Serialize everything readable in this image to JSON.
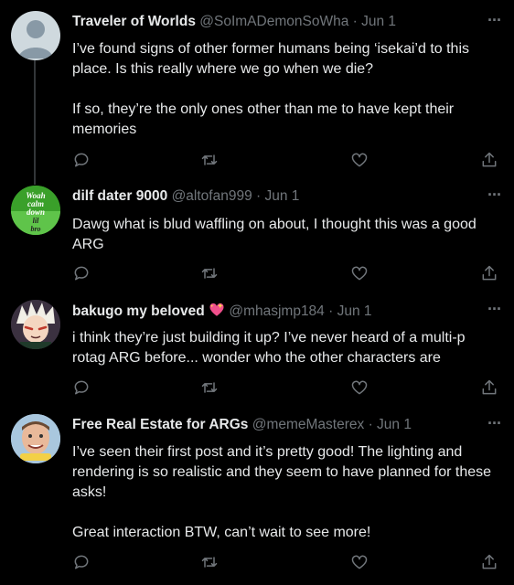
{
  "tweets": [
    {
      "name": "Traveler of Worlds",
      "handle": "@SoImADemonSoWha",
      "dot": "·",
      "date": "Jun 1",
      "more": "···",
      "paragraphs": [
        "I’ve found signs of other former humans being ‘isekai’d to this place. Is this really where we go when we die?",
        "If so, they’re the only ones other than me to have kept their memories"
      ],
      "avatar": "default-avatar"
    },
    {
      "name": "dilf dater 9000",
      "handle": "@altofan999",
      "dot": "·",
      "date": "Jun 1",
      "more": "···",
      "paragraphs": [
        "Dawg what is blud waffling on about, I thought this was a good ARG"
      ],
      "avatar": "green-meme-avatar",
      "avatar_text": [
        "Woah",
        "calm",
        "down",
        "lil",
        "bro"
      ]
    },
    {
      "name": "bakugo my beloved",
      "name_emoji": "sparkling-heart",
      "handle": "@mhasjmp184",
      "dot": "·",
      "date": "Jun 1",
      "more": "···",
      "paragraphs": [
        "i think they’re just building it up? I’ve never heard of a multi-p rotag ARG before... wonder who the other characters are"
      ],
      "avatar": "anime-character-avatar"
    },
    {
      "name": "Free Real Estate for ARGs",
      "handle": "@memeMasterex",
      "dot": "·",
      "date": "Jun 1",
      "more": "···",
      "paragraphs": [
        "I’ve seen their first post and it’s pretty good! The lighting and rendering is so realistic and they seem to have planned for these asks!",
        "Great interaction BTW, can’t wait to see more!"
      ],
      "avatar": "meme-man-avatar"
    }
  ],
  "colors": {
    "background": "#000000",
    "text": "#e7e9ea",
    "muted": "#71767b",
    "line": "#333639"
  },
  "icons": [
    "reply-icon",
    "retweet-icon",
    "like-icon",
    "share-icon",
    "more-icon"
  ]
}
